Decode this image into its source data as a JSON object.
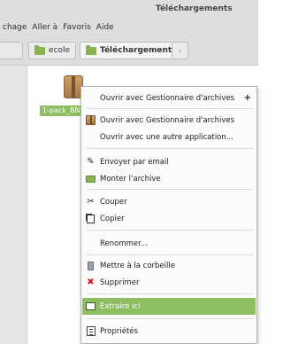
{
  "window": {
    "title": "Téléchargements"
  },
  "menubar": {
    "items": [
      "chage",
      "Aller à",
      "Favoris",
      "Aide"
    ]
  },
  "pathbar": {
    "crumbs": [
      {
        "label": "ecole",
        "active": false
      },
      {
        "label": "Téléchargements",
        "active": true
      }
    ],
    "next_arrow": "›"
  },
  "file": {
    "label": "1-pack_BN"
  },
  "context_menu": {
    "items": [
      {
        "label": "Ouvrir avec Gestionnaire d'archives",
        "icon": "none",
        "submenu": "+"
      },
      {
        "label": "Ouvrir avec Gestionnaire d'archives",
        "icon": "archive-icon"
      },
      {
        "label": "Ouvrir avec une autre application...",
        "icon": "none"
      },
      {
        "label": "Envoyer par email",
        "icon": "attachment-icon"
      },
      {
        "label": "Monter l'archive",
        "icon": "drive-icon"
      },
      {
        "label": "Couper",
        "icon": "scissors-icon"
      },
      {
        "label": "Copier",
        "icon": "copy-icon"
      },
      {
        "label": "Renommer...",
        "icon": "none"
      },
      {
        "label": "Mettre à la corbeille",
        "icon": "trash-icon"
      },
      {
        "label": "Supprimer",
        "icon": "delete-icon"
      },
      {
        "label": "Extraire ici",
        "icon": "extract-icon",
        "highlighted": true
      },
      {
        "label": "Propriétés",
        "icon": "properties-icon"
      }
    ]
  },
  "colors": {
    "accent": "#8fbd62",
    "chrome": "#dedede",
    "delete": "#d01c1c"
  }
}
